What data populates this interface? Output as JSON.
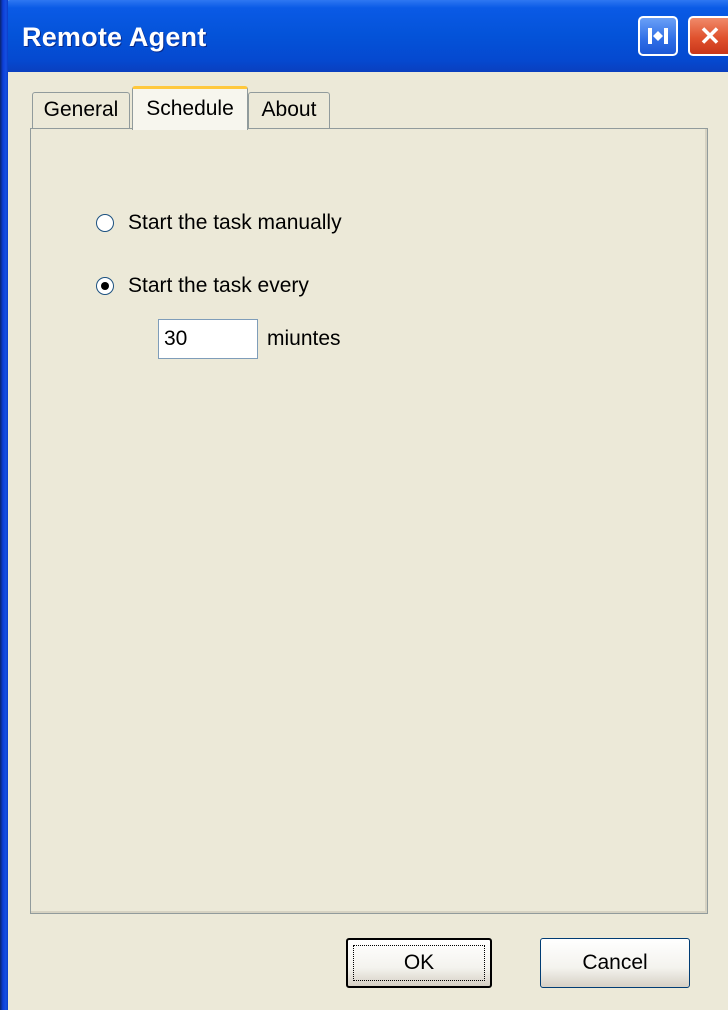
{
  "window": {
    "title": "Remote Agent"
  },
  "titlebar_buttons": {
    "help_icon": "help-icon",
    "close_icon": "close-icon",
    "help_glyph": "⍓",
    "close_glyph": "✕"
  },
  "tabs": [
    {
      "label": "General",
      "active": false
    },
    {
      "label": "Schedule",
      "active": true
    },
    {
      "label": "About",
      "active": false
    }
  ],
  "schedule": {
    "option_manual": {
      "label": "Start the task manually",
      "checked": false
    },
    "option_every": {
      "label": "Start the task every",
      "checked": true
    },
    "interval_value": "30",
    "interval_unit": "miuntes"
  },
  "buttons": {
    "ok": "OK",
    "cancel": "Cancel"
  }
}
